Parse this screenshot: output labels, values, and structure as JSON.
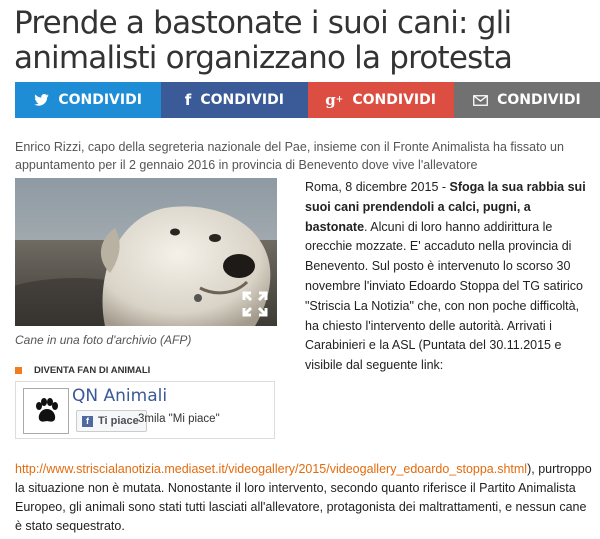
{
  "article": {
    "title": "Prende a bastonate i suoi cani: gli animalisti organizzano la protesta",
    "subtitle": "Enrico Rizzi, capo della segreteria nazionale del Pae, insieme con il Fronte Animalista ha fissato un appuntamento per il 2 gennaio 2016 in provincia di Benevento dove vive l'allevatore",
    "photo_caption": "Cane in una foto d'archivio (AFP)",
    "body_p1": "Roma, 8 dicembre 2015 - ",
    "body_p1_bold": "Sfoga la sua rabbia sui suoi cani prendendoli a calci, pugni, a bastonate",
    "body_p1_rest": ". Alcuni di loro hanno addirittura le orecchie mozzate. E' accaduto nella provincia di Benevento. Sul posto è intervenuto lo scorso 30 novembre l'inviato Edoardo Stoppa del TG satirico \"Striscia La Notizia\" che, con non poche difficoltà, ha chiesto l'intervento delle autorità. Arrivati i Carabinieri e la ASL (Puntata del 30.11.2015 e visibile dal seguente link:",
    "link_url": "http://www.striscialanotizia.mediaset.it/videogallery/2015/videogallery_edoardo_stoppa.shtml",
    "body_p2": "), purtroppo la situazione non è mutata. Nonostante il loro intervento, secondo quanto riferisce il Partito Animalista Europeo, gli animali sono stati tutti lasciati all'allevatore, protagonista dei maltrattamenti, e nessun cane è stato sequestrato."
  },
  "share": [
    {
      "icon": "twitter-icon",
      "label": "CONDIVIDI",
      "color": "#1f8dd6"
    },
    {
      "icon": "facebook-icon",
      "label": "CONDIVIDI",
      "color": "#3a5a98"
    },
    {
      "icon": "google-plus-icon",
      "label": "CONDIVIDI",
      "color": "#dc4e41"
    },
    {
      "icon": "email-icon",
      "label": "CONDIVIDI",
      "color": "#717171"
    }
  ],
  "fan_widget": {
    "label": "DIVENTA FAN DI ANIMALI",
    "page_name": "QN Animali",
    "like_button": "Ti piace",
    "like_count": "3mila \"Mi piace\""
  },
  "colors": {
    "link": "#e36b0e",
    "accent_dot": "#f07d1e",
    "facebook_blue": "#3b5998"
  }
}
